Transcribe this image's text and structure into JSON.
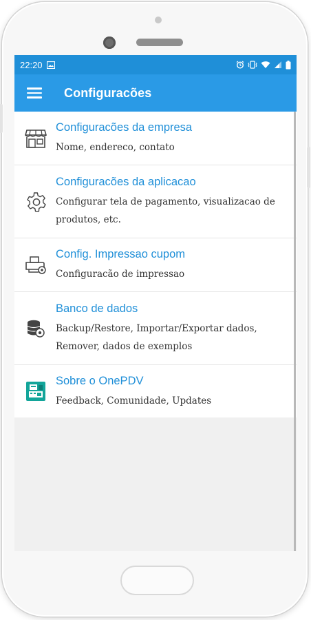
{
  "status_bar": {
    "time": "22:20",
    "icons": [
      "image-icon",
      "alarm-icon",
      "vibrate-icon",
      "wifi-icon",
      "signal-icon",
      "battery-icon"
    ]
  },
  "app_bar": {
    "title": "Configuracões",
    "menu_icon": "hamburger-menu-icon"
  },
  "settings_list": [
    {
      "title": "Configuracões da empresa",
      "subtitle": "Nome, endereco, contato",
      "icon": "storefront-icon"
    },
    {
      "title": "Configuracões da aplicacao",
      "subtitle": "Configurar tela de pagamento, visualizacao de produtos, etc.",
      "icon": "gear-icon"
    },
    {
      "title": "Config. Impressao cupom",
      "subtitle": "Configuracão de impressao",
      "icon": "printer-icon"
    },
    {
      "title": "Banco de dados",
      "subtitle": "Backup/Restore, Importar/Exportar dados, Remover, dados de exemplos",
      "icon": "database-icon"
    },
    {
      "title": "Sobre o OnePDV",
      "subtitle": "Feedback, Comunidade, Updates",
      "icon": "pos-terminal-icon"
    }
  ],
  "colors": {
    "status_bar": "#1f8fd8",
    "app_bar": "#2a9ae6",
    "accent_text": "#1f8fd8",
    "about_icon": "#13a59a"
  }
}
